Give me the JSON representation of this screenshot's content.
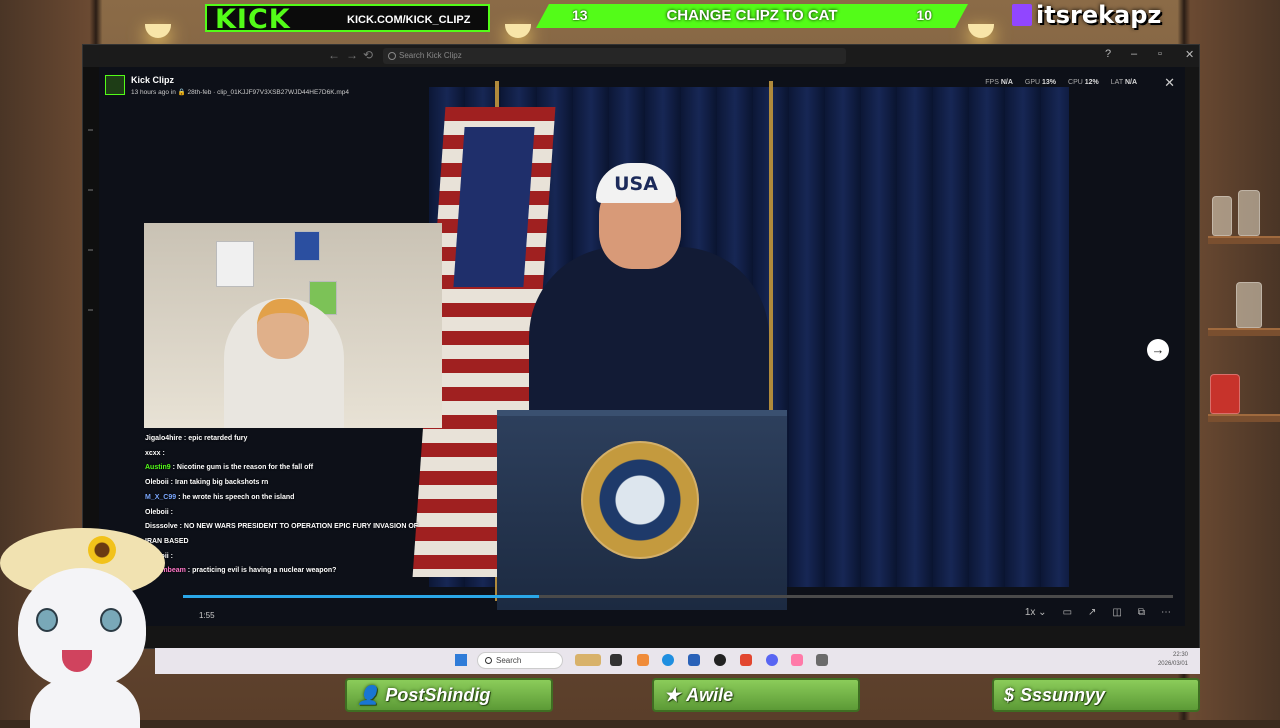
{
  "overlay": {
    "kick_logo": "KICK",
    "kick_url": "KICK.COM/KICK_CLIPZ",
    "goal": {
      "left": "13",
      "text": "CHANGE CLIPZ TO CAT",
      "right": "10"
    },
    "twitch_name": "itsrekapz",
    "bottom_bars": [
      {
        "icon": "person-icon",
        "label": "PostShindig"
      },
      {
        "icon": "star-icon",
        "label": "Awile"
      },
      {
        "icon": "dollar-icon",
        "label": "Sssunnyy"
      }
    ]
  },
  "window": {
    "search_placeholder": "Search Kick Clipz",
    "nav": {
      "back": "←",
      "forward": "→",
      "history": "⟲"
    },
    "controls": {
      "help": "?",
      "minimize": "–",
      "maximize": "▫",
      "close": "✕"
    }
  },
  "clip": {
    "channel": "Kick Clipz",
    "meta": "13 hours ago in 🔒 28th-feb · clip_01KJJF97V3XSB27WJD44HE7D6K.mp4",
    "stats": {
      "fps_label": "FPS",
      "fps": "N/A",
      "gpu_label": "GPU",
      "gpu": "13%",
      "cpu_label": "CPU",
      "cpu": "12%",
      "lat_label": "LAT",
      "lat": "N/A"
    },
    "close": "✕",
    "hat_text": "USA",
    "progress": 0.36,
    "time": "1:55",
    "speed": "1x ⌄",
    "next": "→",
    "more": "⋯"
  },
  "chat": [
    {
      "user": "Jigalo4hire",
      "color": "#ffffff",
      "msg": "epic retarded fury"
    },
    {
      "user": "xcxx",
      "color": "#ffffff",
      "msg": ""
    },
    {
      "user": "Austin9",
      "color": "#53fc18",
      "msg": "Nicotine gum is the reason for the fall off"
    },
    {
      "user": "Oleboii",
      "color": "#ffffff",
      "msg": "Iran taking big backshots rn"
    },
    {
      "user": "M_X_C99",
      "color": "#7aa7ff",
      "msg": "he wrote his speech on the island"
    },
    {
      "user": "Oleboii",
      "color": "#ffffff",
      "msg": ""
    },
    {
      "user": "Disssolve",
      "color": "#ffffff",
      "msg": "NO NEW WARS PRESIDENT TO OPERATION EPIC FURY INVASION OF"
    },
    {
      "user": "",
      "color": "#ffffff",
      "msg": "IRAN BASED"
    },
    {
      "user": "Oleboii",
      "color": "#ffffff",
      "msg": ""
    },
    {
      "user": "justjimbeam",
      "color": "#ff77c8",
      "msg": "practicing evil is having a nuclear weapon?"
    }
  ],
  "taskbar": {
    "search": "Search",
    "time": "22:30",
    "date": "2026/03/01"
  }
}
